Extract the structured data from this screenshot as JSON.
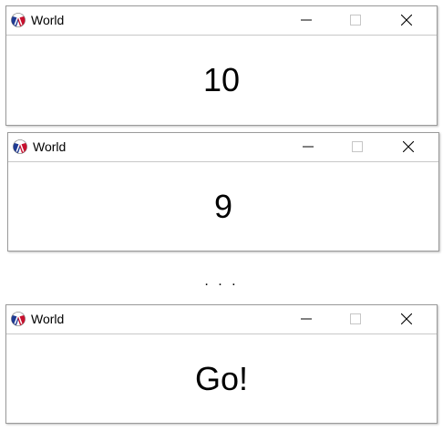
{
  "windows": [
    {
      "title": "World",
      "display": "10"
    },
    {
      "title": "World",
      "display": "9"
    },
    {
      "title": "World",
      "display": "Go!"
    }
  ],
  "separator": ". . .",
  "icons": {
    "app": "racket-logo-icon",
    "minimize": "minimize-icon",
    "maximize": "maximize-icon",
    "close": "close-icon"
  },
  "colors": {
    "logo_red": "#c8102e",
    "logo_blue": "#1f3a93",
    "disabled_control": "#c6c6c6"
  }
}
